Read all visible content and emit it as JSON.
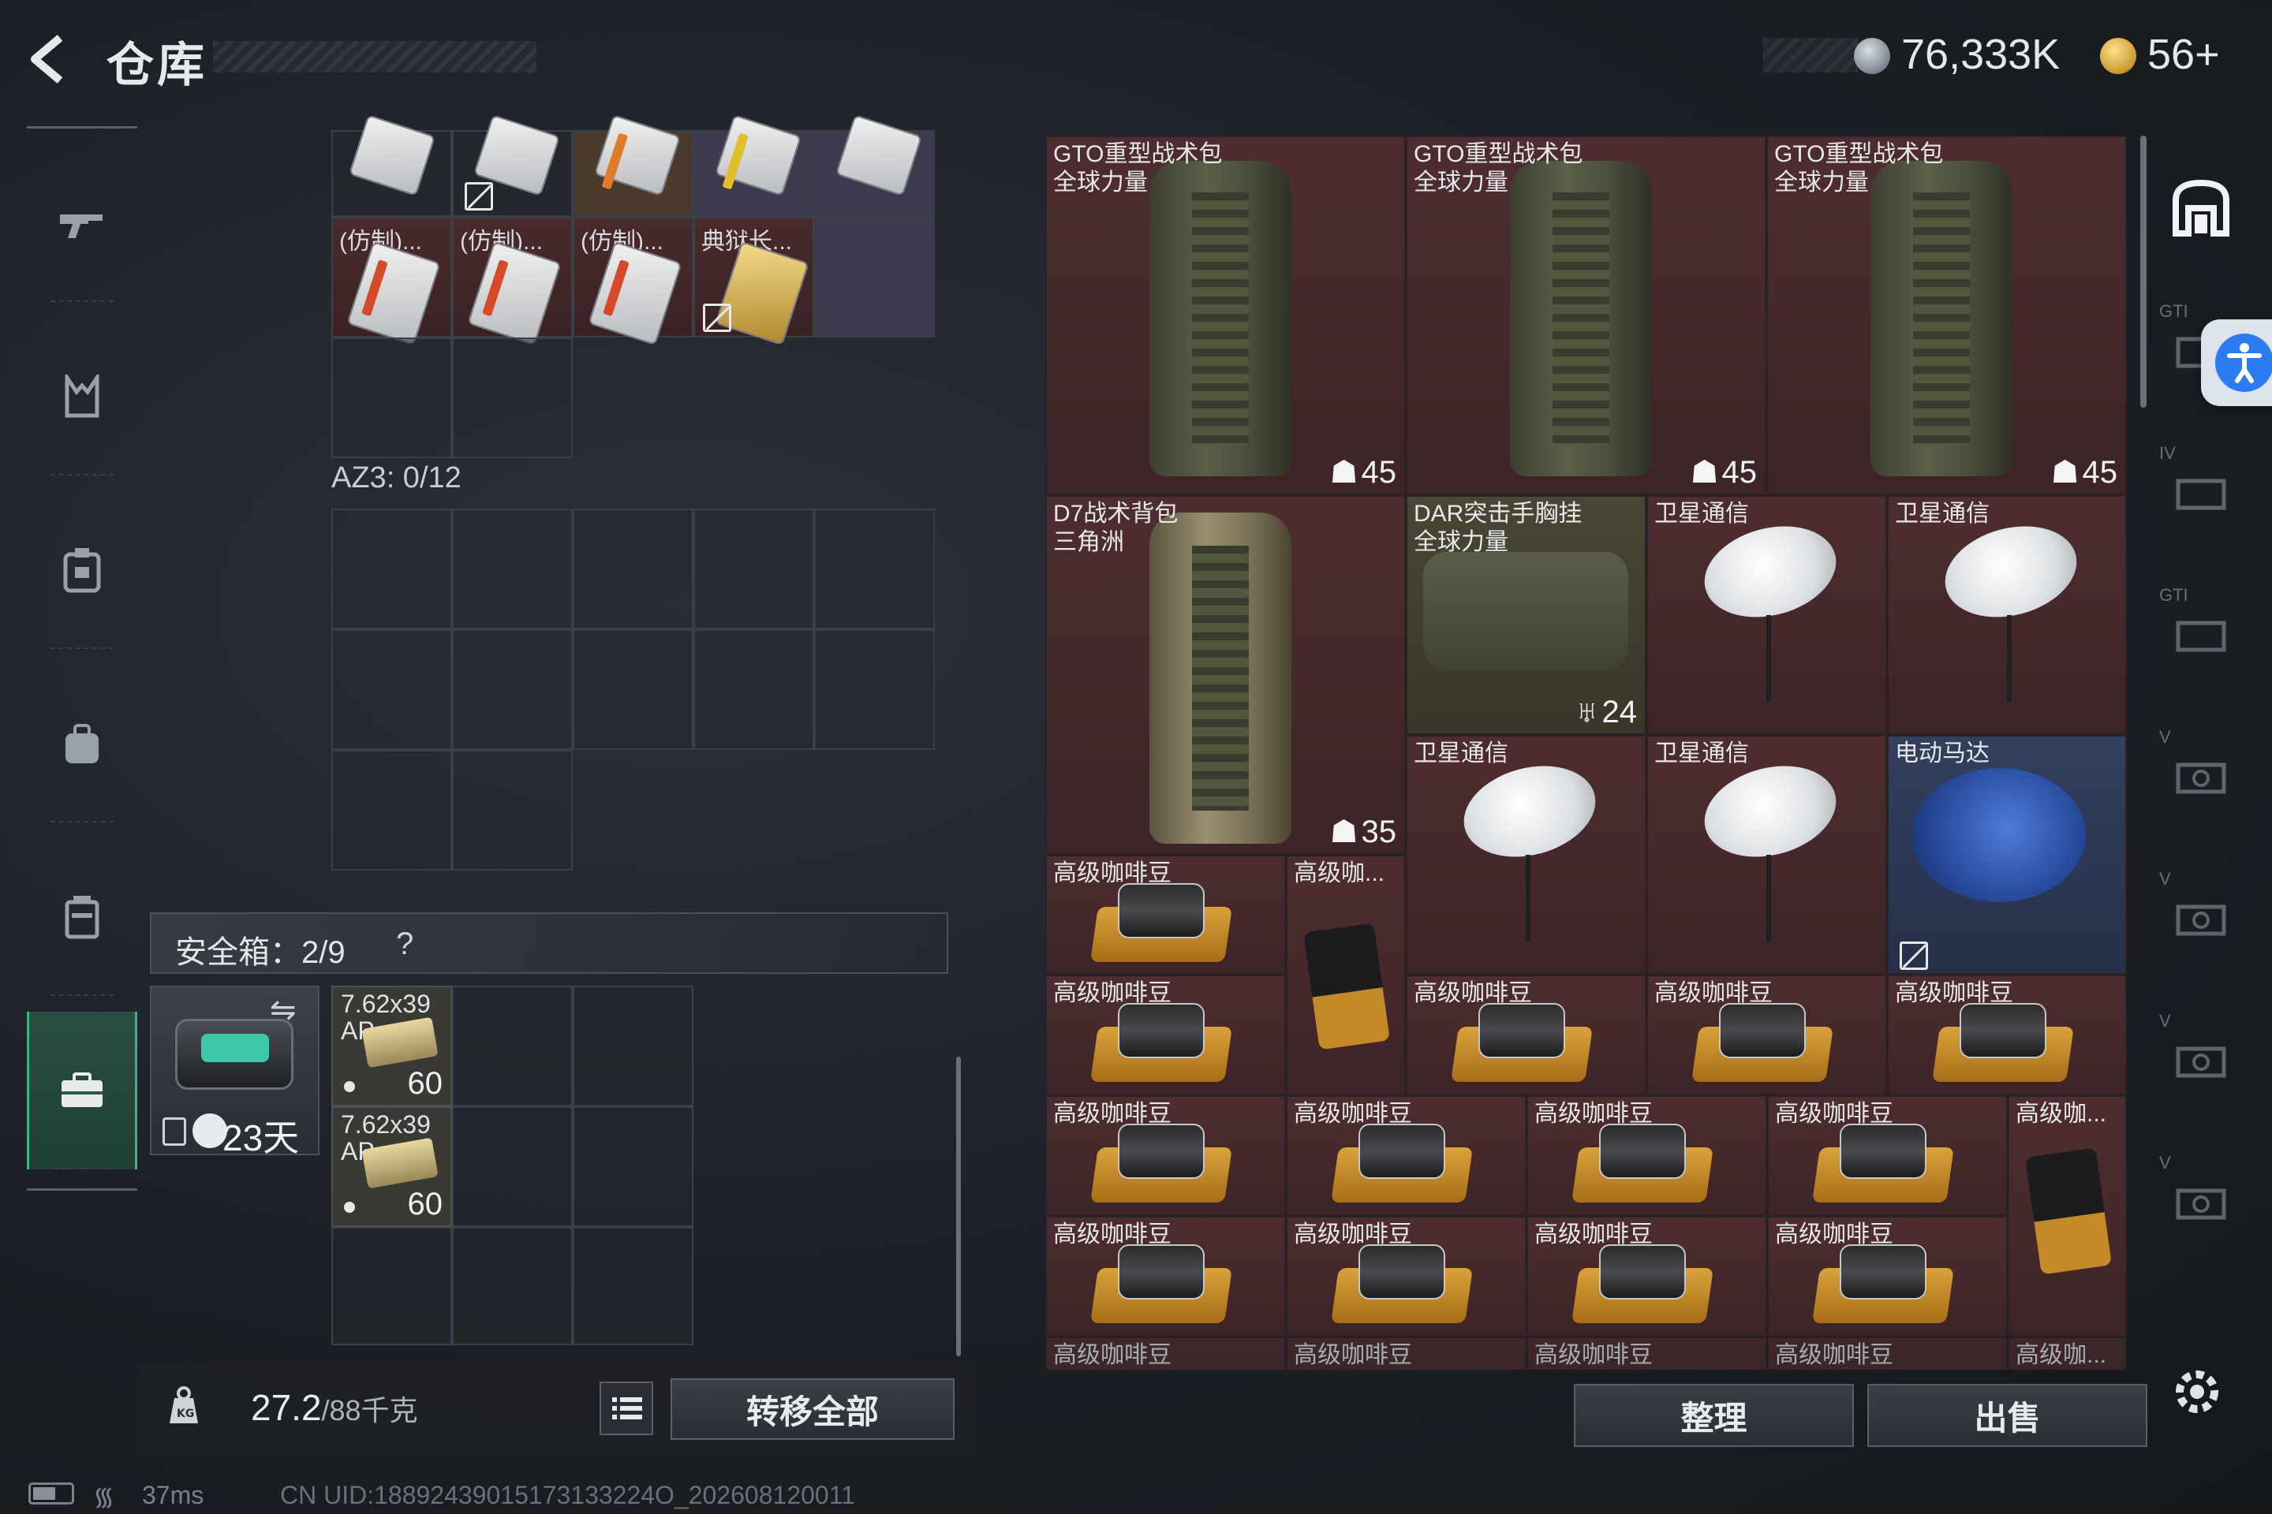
{
  "header": {
    "title": "仓库",
    "currency_silver": "76,333K",
    "currency_gold": "56+"
  },
  "left_rail": {
    "items": [
      {
        "name": "weapon-icon"
      },
      {
        "name": "vest-icon"
      },
      {
        "name": "armor-icon"
      },
      {
        "name": "backpack-icon"
      },
      {
        "name": "pouch-icon"
      },
      {
        "name": "safe-box-icon"
      }
    ]
  },
  "left_panel": {
    "card_labels": [
      "(仿制)...",
      "(仿制)...",
      "(仿制)...",
      "典狱长..."
    ],
    "az3_label": "AZ3: 0/12",
    "safe_box_label": "安全箱：2/9",
    "safe_box_help": "?",
    "safe_box_days": "23天",
    "ammo": [
      {
        "label_line1": "7.62x39",
        "label_line2": "AP",
        "count": "60"
      },
      {
        "label_line1": "7.62x39",
        "label_line2": "AP",
        "count": "60"
      }
    ]
  },
  "bottom_left": {
    "weight_current": "27.2",
    "weight_max": "/88千克",
    "transfer_label": "转移全部"
  },
  "warehouse": {
    "backpacks": [
      {
        "label1": "GTO重型战术包",
        "label2": "全球力量",
        "count": "45"
      },
      {
        "label1": "GTO重型战术包",
        "label2": "全球力量",
        "count": "45"
      },
      {
        "label1": "GTO重型战术包",
        "label2": "全球力量",
        "count": "45"
      },
      {
        "label1": "D7战术背包",
        "label2": "三角洲",
        "count": "35"
      }
    ],
    "vest": {
      "label1": "DAR突击手胸挂",
      "label2": "全球力量",
      "count": "24"
    },
    "satellite_label": "卫星通信",
    "motor_label": "电动马达",
    "coffee_label": "高级咖啡豆",
    "coffee_short": "高级咖..."
  },
  "bottom_right": {
    "sort_label": "整理",
    "sell_label": "出售"
  },
  "right_tabs": [
    "GTI",
    "IV",
    "GTI",
    "V",
    "V",
    "V",
    "V"
  ],
  "status": {
    "ping": "37ms",
    "uid": "CN UID:18892439015173133224O_202608120011"
  }
}
